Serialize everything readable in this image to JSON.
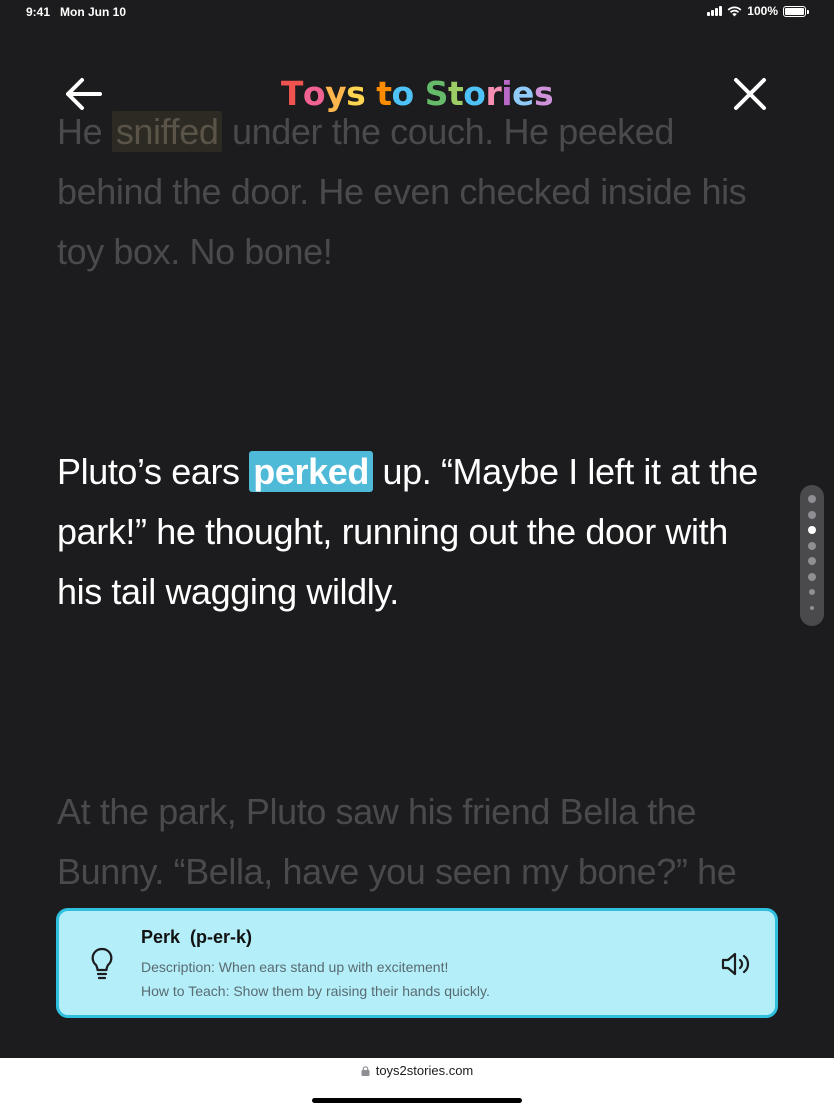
{
  "status_bar": {
    "time": "9:41",
    "date": "Mon Jun 10",
    "battery": "100%"
  },
  "header": {
    "logo_letters": [
      {
        "ch": "T",
        "color": "#ef5350"
      },
      {
        "ch": "o",
        "color": "#f06292"
      },
      {
        "ch": "y",
        "color": "#ffb74d"
      },
      {
        "ch": "s",
        "color": "#ffd54f"
      },
      {
        "ch": " ",
        "color": "#ffffff"
      },
      {
        "ch": "t",
        "color": "#fb8c00"
      },
      {
        "ch": "o",
        "color": "#4fc3f7"
      },
      {
        "ch": " ",
        "color": "#ffffff"
      },
      {
        "ch": "S",
        "color": "#66bb6a"
      },
      {
        "ch": "t",
        "color": "#9ccc65"
      },
      {
        "ch": "o",
        "color": "#4fc3f7"
      },
      {
        "ch": "r",
        "color": "#f48fb1"
      },
      {
        "ch": "i",
        "color": "#ba68c8"
      },
      {
        "ch": "e",
        "color": "#90caf9"
      },
      {
        "ch": "s",
        "color": "#ce93d8"
      }
    ],
    "back_icon": "arrow-left-icon",
    "close_icon": "close-icon"
  },
  "story": {
    "paragraphs": [
      {
        "state": "dim",
        "before": "He ",
        "highlight": "sniffed",
        "after": " under the couch. He peeked behind the door. He even checked inside his toy box. No bone!"
      },
      {
        "state": "active",
        "before": "Pluto’s ears ",
        "highlight": "perked",
        "after": " up. “Maybe I left it at the park!” he thought, running out the door with his tail wagging wildly."
      },
      {
        "state": "dim",
        "before": "At the park, Pluto saw his friend Bella the Bunny. “Bella, have you seen my bone?” he asked sadly.",
        "highlight": "",
        "after": ""
      }
    ]
  },
  "scroll_indicator": {
    "page_count": 8,
    "current_page": 3
  },
  "word_card": {
    "word": "Perk",
    "phonetic": "(p-er-k)",
    "description": "Description: When ears stand up with excitement!",
    "how_to_teach": "How to Teach: Show them by raising their hands quickly.",
    "icons": [
      "lightbulb-icon",
      "speaker-icon"
    ],
    "background": "#b3eef9",
    "border": "#2fc0e0"
  },
  "browser": {
    "url": "toys2stories.com"
  },
  "colors": {
    "background": "#1c1c1e",
    "highlight_active": "#4fb9d8",
    "text_dim": "#4a4a4c"
  }
}
